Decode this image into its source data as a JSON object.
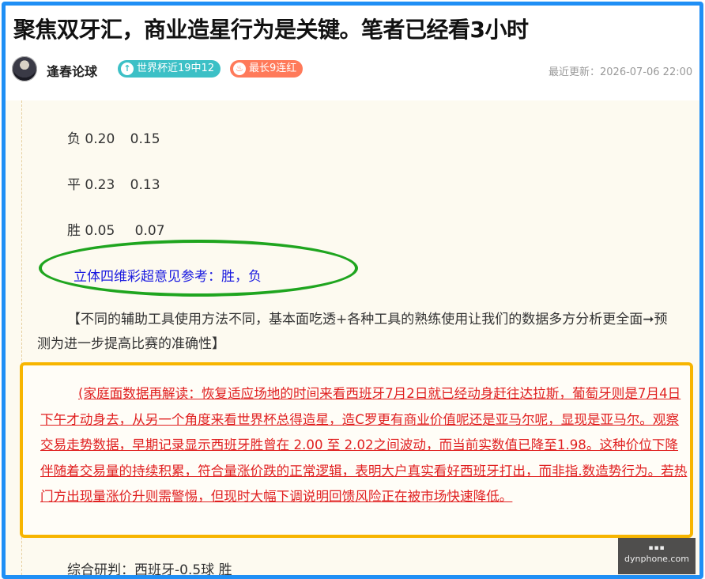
{
  "article": {
    "title": "聚焦双牙汇，商业造星行为是关键。笔者已经看3小时"
  },
  "meta": {
    "author": "逢春论球",
    "badge_record": "世界杯近19中12",
    "badge_streak": "最长9连红",
    "badge_record_icon": "thumb-up-icon",
    "badge_streak_icon": "fire-icon",
    "updated": "最近更新：2026-07-06 22:00"
  },
  "odds": [
    {
      "label": "负",
      "v1": "0.20",
      "v2": "0.15"
    },
    {
      "label": "平",
      "v1": "0.23",
      "v2": "0.13"
    },
    {
      "label": "胜",
      "v1": "0.05",
      "v2": "0.07"
    }
  ],
  "pick": "立体四维彩超意见参考：胜，负",
  "note": "【不同的辅助工具使用方法不同，基本面吃透+各种工具的熟练使用让我们的数据多方分析更全面➞预测为进一步提高比赛的准确性】",
  "analysis": "(家庭面数据再解读：恢复适应场地的时间来看西班牙7月2日就已经动身赶往达拉斯，葡萄牙则是7月4日下午才动身去，从另一个角度来看世界杯总得造星，造C罗更有商业价值呢还是亚马尔呢，显现是亚马尔。观察交易走势数据，早期记录显示西班牙胜曾在 2.00 至 2.02之间波动，而当前实数值已降至1.98。这种价位下降伴随着交易量的持续积累，符合量涨价跌的正常逻辑，表明大户真实看好西班牙打出，而非指.数造势行为。若热门方出现量涨价升则需警惕，但现时大幅下调说明回馈风险正在被市场快速降低。",
  "summary": "综合研判：西班牙-0.5球 胜",
  "watermark": {
    "line2": "dynphone.com"
  },
  "colors": {
    "frame": "#1f8ff5",
    "ellipse": "#1fa51f",
    "highlight_box": "#f7b500",
    "analysis_text": "#e02020",
    "pick_text": "#1a1ae0"
  }
}
